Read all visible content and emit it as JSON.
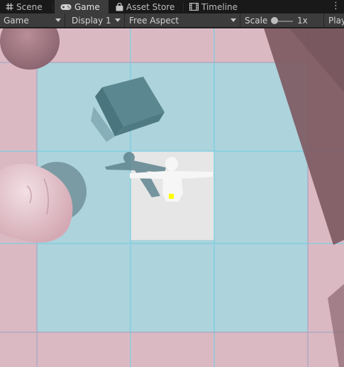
{
  "tabs": [
    {
      "label": "Scene",
      "icon": "grid-icon",
      "active": false
    },
    {
      "label": "Game",
      "icon": "gamepad-icon",
      "active": true
    },
    {
      "label": "Asset Store",
      "icon": "bag-icon",
      "active": false
    },
    {
      "label": "Timeline",
      "icon": "film-icon",
      "active": false
    }
  ],
  "toolbar": {
    "display_mode": "Game",
    "display": "Display 1",
    "aspect": "Free Aspect",
    "scale_label": "Scale",
    "scale_value": "1x",
    "scale_level": 0.0,
    "play_label": "Play"
  },
  "colors": {
    "floor_pink": "#dbb9c3",
    "floor_blue": "#add3dc",
    "floor_white": "#e9e9e9",
    "grid_pink": "#e2839d",
    "grid_blue": "#78cfe3",
    "selection_yellow": "#ffff00"
  }
}
